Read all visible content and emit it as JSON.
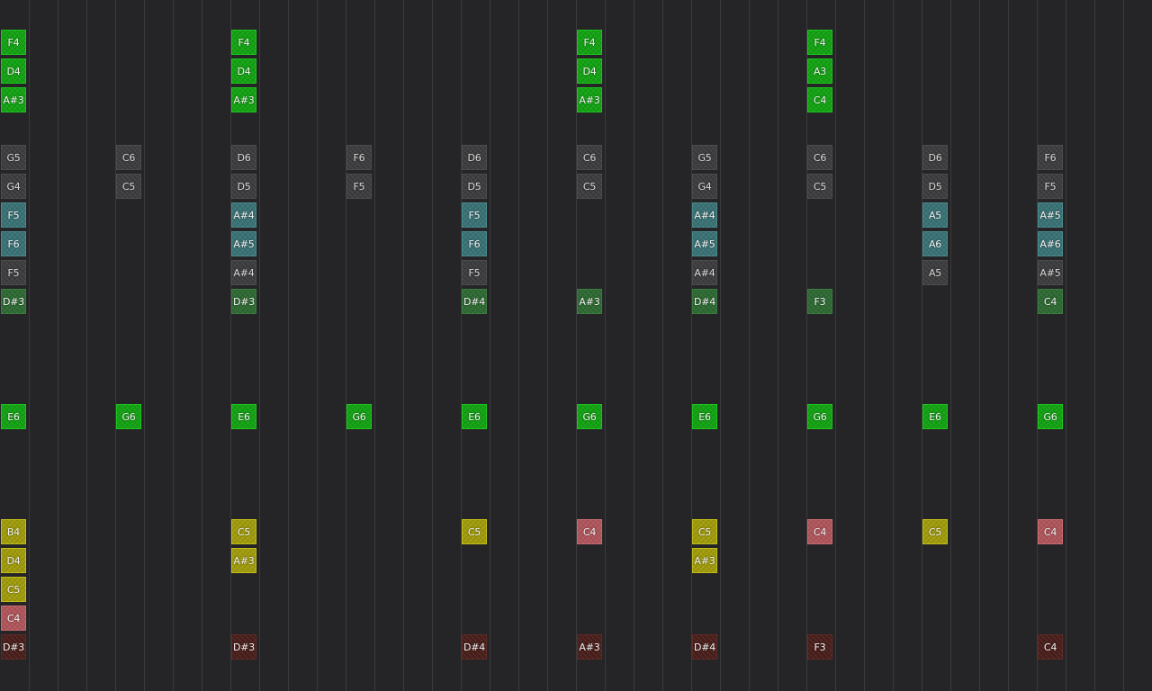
{
  "grid": {
    "note_colors": {
      "green": "#13a313",
      "gray": "#3d3d3f",
      "teal": "#3a7376",
      "dkgreen": "#2e6a33",
      "olive": "#a19c0c",
      "rose": "#b0565c",
      "brown": "#4a1f1b"
    },
    "notes": [
      {
        "label": "F4",
        "step": 0,
        "row": 0,
        "kind": "green"
      },
      {
        "label": "D4",
        "step": 0,
        "row": 1,
        "kind": "green"
      },
      {
        "label": "A#3",
        "step": 0,
        "row": 2,
        "kind": "green"
      },
      {
        "label": "F4",
        "step": 8,
        "row": 0,
        "kind": "green"
      },
      {
        "label": "D4",
        "step": 8,
        "row": 1,
        "kind": "green"
      },
      {
        "label": "A#3",
        "step": 8,
        "row": 2,
        "kind": "green"
      },
      {
        "label": "F4",
        "step": 20,
        "row": 0,
        "kind": "green"
      },
      {
        "label": "D4",
        "step": 20,
        "row": 1,
        "kind": "green"
      },
      {
        "label": "A#3",
        "step": 20,
        "row": 2,
        "kind": "green"
      },
      {
        "label": "F4",
        "step": 28,
        "row": 0,
        "kind": "green"
      },
      {
        "label": "A3",
        "step": 28,
        "row": 1,
        "kind": "green"
      },
      {
        "label": "C4",
        "step": 28,
        "row": 2,
        "kind": "green"
      },
      {
        "label": "G5",
        "step": 0,
        "row": 4,
        "kind": "gray"
      },
      {
        "label": "G4",
        "step": 0,
        "row": 5,
        "kind": "gray"
      },
      {
        "label": "F5",
        "step": 0,
        "row": 6,
        "kind": "teal"
      },
      {
        "label": "F6",
        "step": 0,
        "row": 7,
        "kind": "teal"
      },
      {
        "label": "F5",
        "step": 0,
        "row": 8,
        "kind": "gray"
      },
      {
        "label": "D#3",
        "step": 0,
        "row": 9,
        "kind": "dkgreen"
      },
      {
        "label": "C6",
        "step": 4,
        "row": 4,
        "kind": "gray"
      },
      {
        "label": "C5",
        "step": 4,
        "row": 5,
        "kind": "gray"
      },
      {
        "label": "D6",
        "step": 8,
        "row": 4,
        "kind": "gray"
      },
      {
        "label": "D5",
        "step": 8,
        "row": 5,
        "kind": "gray"
      },
      {
        "label": "A#4",
        "step": 8,
        "row": 6,
        "kind": "teal"
      },
      {
        "label": "A#5",
        "step": 8,
        "row": 7,
        "kind": "teal"
      },
      {
        "label": "A#4",
        "step": 8,
        "row": 8,
        "kind": "gray"
      },
      {
        "label": "D#3",
        "step": 8,
        "row": 9,
        "kind": "dkgreen"
      },
      {
        "label": "F6",
        "step": 12,
        "row": 4,
        "kind": "gray"
      },
      {
        "label": "F5",
        "step": 12,
        "row": 5,
        "kind": "gray"
      },
      {
        "label": "D6",
        "step": 16,
        "row": 4,
        "kind": "gray"
      },
      {
        "label": "D5",
        "step": 16,
        "row": 5,
        "kind": "gray"
      },
      {
        "label": "F5",
        "step": 16,
        "row": 6,
        "kind": "teal"
      },
      {
        "label": "F6",
        "step": 16,
        "row": 7,
        "kind": "teal"
      },
      {
        "label": "F5",
        "step": 16,
        "row": 8,
        "kind": "gray"
      },
      {
        "label": "D#4",
        "step": 16,
        "row": 9,
        "kind": "dkgreen"
      },
      {
        "label": "C6",
        "step": 20,
        "row": 4,
        "kind": "gray"
      },
      {
        "label": "C5",
        "step": 20,
        "row": 5,
        "kind": "gray"
      },
      {
        "label": "A#3",
        "step": 20,
        "row": 9,
        "kind": "dkgreen"
      },
      {
        "label": "G5",
        "step": 24,
        "row": 4,
        "kind": "gray"
      },
      {
        "label": "G4",
        "step": 24,
        "row": 5,
        "kind": "gray"
      },
      {
        "label": "A#4",
        "step": 24,
        "row": 6,
        "kind": "teal"
      },
      {
        "label": "A#5",
        "step": 24,
        "row": 7,
        "kind": "teal"
      },
      {
        "label": "A#4",
        "step": 24,
        "row": 8,
        "kind": "gray"
      },
      {
        "label": "D#4",
        "step": 24,
        "row": 9,
        "kind": "dkgreen"
      },
      {
        "label": "C6",
        "step": 28,
        "row": 4,
        "kind": "gray"
      },
      {
        "label": "C5",
        "step": 28,
        "row": 5,
        "kind": "gray"
      },
      {
        "label": "F3",
        "step": 28,
        "row": 9,
        "kind": "dkgreen"
      },
      {
        "label": "D6",
        "step": 32,
        "row": 4,
        "kind": "gray"
      },
      {
        "label": "D5",
        "step": 32,
        "row": 5,
        "kind": "gray"
      },
      {
        "label": "A5",
        "step": 32,
        "row": 6,
        "kind": "teal"
      },
      {
        "label": "A6",
        "step": 32,
        "row": 7,
        "kind": "teal"
      },
      {
        "label": "A5",
        "step": 32,
        "row": 8,
        "kind": "gray"
      },
      {
        "label": "F6",
        "step": 36,
        "row": 4,
        "kind": "gray"
      },
      {
        "label": "F5",
        "step": 36,
        "row": 5,
        "kind": "gray"
      },
      {
        "label": "A#5",
        "step": 36,
        "row": 6,
        "kind": "teal"
      },
      {
        "label": "A#6",
        "step": 36,
        "row": 7,
        "kind": "teal"
      },
      {
        "label": "A#5",
        "step": 36,
        "row": 8,
        "kind": "gray"
      },
      {
        "label": "C4",
        "step": 36,
        "row": 9,
        "kind": "dkgreen"
      },
      {
        "label": "E6",
        "step": 0,
        "row": 13,
        "kind": "green"
      },
      {
        "label": "G6",
        "step": 4,
        "row": 13,
        "kind": "green"
      },
      {
        "label": "E6",
        "step": 8,
        "row": 13,
        "kind": "green"
      },
      {
        "label": "G6",
        "step": 12,
        "row": 13,
        "kind": "green"
      },
      {
        "label": "E6",
        "step": 16,
        "row": 13,
        "kind": "green"
      },
      {
        "label": "G6",
        "step": 20,
        "row": 13,
        "kind": "green"
      },
      {
        "label": "E6",
        "step": 24,
        "row": 13,
        "kind": "green"
      },
      {
        "label": "G6",
        "step": 28,
        "row": 13,
        "kind": "green"
      },
      {
        "label": "E6",
        "step": 32,
        "row": 13,
        "kind": "green"
      },
      {
        "label": "G6",
        "step": 36,
        "row": 13,
        "kind": "green"
      },
      {
        "label": "B4",
        "step": 0,
        "row": 17,
        "kind": "olive"
      },
      {
        "label": "D4",
        "step": 0,
        "row": 18,
        "kind": "olive"
      },
      {
        "label": "C5",
        "step": 0,
        "row": 19,
        "kind": "olive"
      },
      {
        "label": "C4",
        "step": 0,
        "row": 20,
        "kind": "rose"
      },
      {
        "label": "D#3",
        "step": 0,
        "row": 21,
        "kind": "brown"
      },
      {
        "label": "C5",
        "step": 8,
        "row": 17,
        "kind": "olive"
      },
      {
        "label": "A#3",
        "step": 8,
        "row": 18,
        "kind": "olive"
      },
      {
        "label": "D#3",
        "step": 8,
        "row": 21,
        "kind": "brown"
      },
      {
        "label": "C5",
        "step": 16,
        "row": 17,
        "kind": "olive"
      },
      {
        "label": "D#4",
        "step": 16,
        "row": 21,
        "kind": "brown"
      },
      {
        "label": "C4",
        "step": 20,
        "row": 17,
        "kind": "rose"
      },
      {
        "label": "A#3",
        "step": 20,
        "row": 21,
        "kind": "brown"
      },
      {
        "label": "C5",
        "step": 24,
        "row": 17,
        "kind": "olive"
      },
      {
        "label": "A#3",
        "step": 24,
        "row": 18,
        "kind": "olive"
      },
      {
        "label": "D#4",
        "step": 24,
        "row": 21,
        "kind": "brown"
      },
      {
        "label": "C4",
        "step": 28,
        "row": 17,
        "kind": "rose"
      },
      {
        "label": "F3",
        "step": 28,
        "row": 21,
        "kind": "brown"
      },
      {
        "label": "C5",
        "step": 32,
        "row": 17,
        "kind": "olive"
      },
      {
        "label": "C4",
        "step": 36,
        "row": 17,
        "kind": "rose"
      },
      {
        "label": "C4",
        "step": 36,
        "row": 21,
        "kind": "brown"
      }
    ]
  }
}
